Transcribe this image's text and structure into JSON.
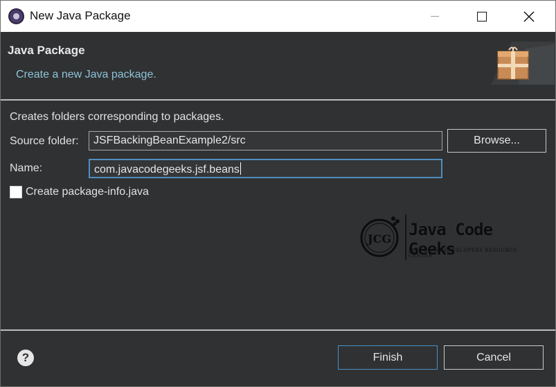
{
  "window": {
    "title": "New Java Package"
  },
  "header": {
    "title": "Java Package",
    "description": "Create a new Java package."
  },
  "form": {
    "description": "Creates folders corresponding to packages.",
    "source_folder_label": "Source folder:",
    "source_folder_value": "JSFBackingBeanExample2/src",
    "browse_label": "Browse...",
    "name_label": "Name:",
    "name_value": "com.javacodegeeks.jsf.beans",
    "create_package_info_label": "Create package-info.java",
    "create_package_info_checked": false
  },
  "watermark": {
    "badge": "JCG",
    "text": "Java Code Geeks",
    "subtext": "JAVA 2 JAVA DEVELOPERS RESOURCE CENTER"
  },
  "footer": {
    "finish_label": "Finish",
    "cancel_label": "Cancel"
  },
  "icons": {
    "app": "eclipse-icon",
    "banner": "package-wizard-icon",
    "help": "help-icon"
  },
  "colors": {
    "dialog_bg": "#2f3133",
    "accent": "#4f8fc2",
    "desc_text": "#8fc3d7"
  }
}
